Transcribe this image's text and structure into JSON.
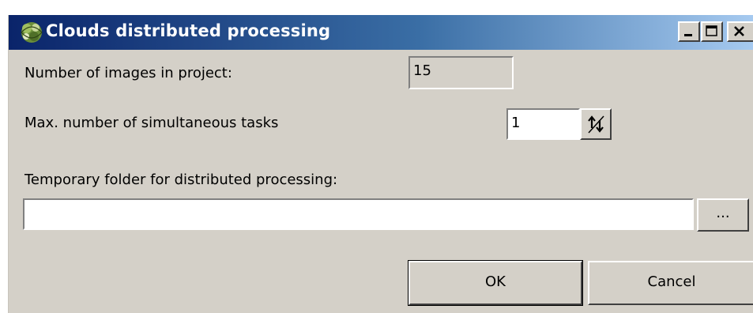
{
  "window": {
    "title": "Clouds distributed processing"
  },
  "titlebar_buttons": [
    "minimize-icon",
    "maximize-icon",
    "close-icon"
  ],
  "form": {
    "images_label": "Number of images in project:",
    "images_value": "15",
    "tasks_label": "Max. number of simultaneous tasks",
    "tasks_value": "1",
    "folder_label": "Temporary folder for distributed processing:",
    "folder_value": "",
    "browse_label": "..."
  },
  "buttons": {
    "ok_label": "OK",
    "cancel_label": "Cancel"
  },
  "colors": {
    "titlebar_start": "#0a246a",
    "titlebar_end": "#a6caf0",
    "dialog_face": "#d4d0c8"
  }
}
